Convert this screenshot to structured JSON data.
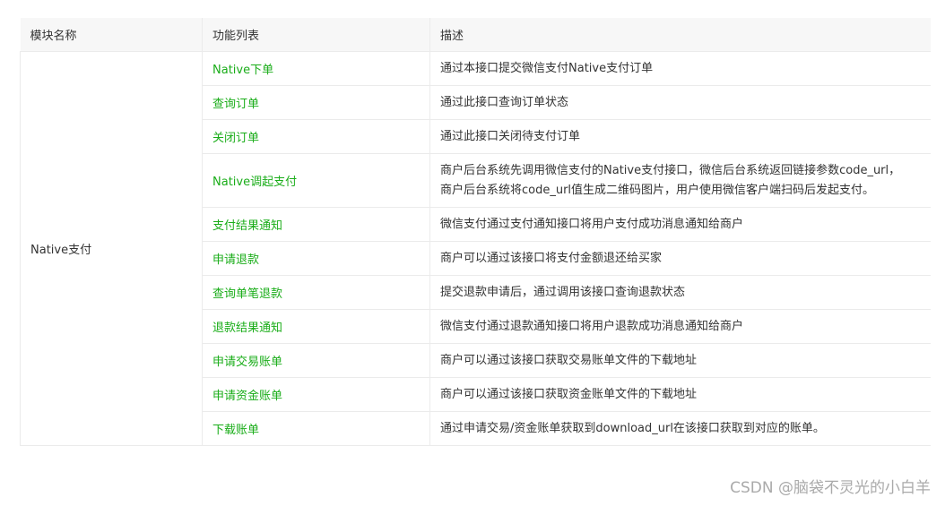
{
  "table": {
    "headers": [
      "模块名称",
      "功能列表",
      "描述"
    ],
    "module": "Native支付",
    "rows": [
      {
        "func": "Native下单",
        "desc": [
          "通过本接口提交微信支付Native支付订单"
        ]
      },
      {
        "func": "查询订单",
        "desc": [
          "通过此接口查询订单状态"
        ]
      },
      {
        "func": "关闭订单",
        "desc": [
          "通过此接口关闭待支付订单"
        ]
      },
      {
        "func": "Native调起支付",
        "desc": [
          "商户后台系统先调用微信支付的Native支付接口，微信后台系统返回链接参数code_url，",
          "商户后台系统将code_url值生成二维码图片，用户使用微信客户端扫码后发起支付。"
        ]
      },
      {
        "func": "支付结果通知",
        "desc": [
          "微信支付通过支付通知接口将用户支付成功消息通知给商户"
        ]
      },
      {
        "func": "申请退款",
        "desc": [
          "商户可以通过该接口将支付金额退还给买家"
        ]
      },
      {
        "func": "查询单笔退款",
        "desc": [
          "提交退款申请后，通过调用该接口查询退款状态"
        ]
      },
      {
        "func": "退款结果通知",
        "desc": [
          "微信支付通过退款通知接口将用户退款成功消息通知给商户"
        ]
      },
      {
        "func": "申请交易账单",
        "desc": [
          "商户可以通过该接口获取交易账单文件的下载地址"
        ]
      },
      {
        "func": "申请资金账单",
        "desc": [
          "商户可以通过该接口获取资金账单文件的下载地址"
        ]
      },
      {
        "func": "下载账单",
        "desc": [
          "通过申请交易/资金账单获取到download_url在该接口获取到对应的账单。"
        ]
      }
    ]
  },
  "watermark": "CSDN @脑袋不灵光的小白羊"
}
